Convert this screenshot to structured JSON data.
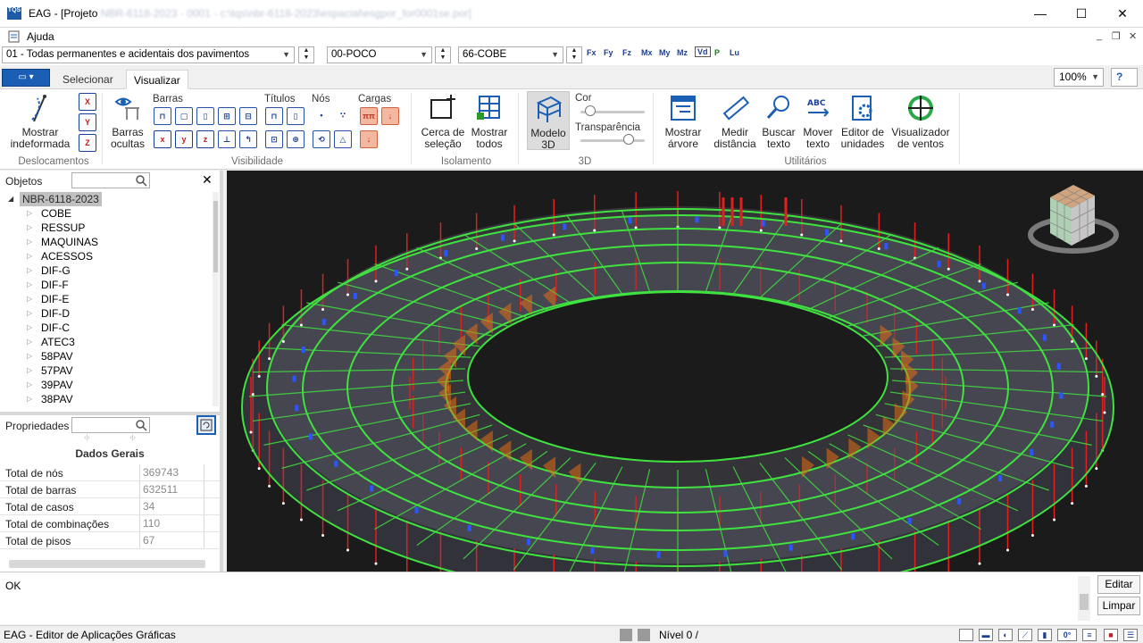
{
  "window": {
    "app_name": "EAG",
    "title_prefix": "EAG - [Projeto",
    "title_obscured": "NBR-6118-2023 - 0001 - c:\\tqs\\nbr-6118-2023\\espacial\\esgpor_for0001se.por]",
    "icon_label": "TQS",
    "minimize": "—",
    "maximize": "☐",
    "close": "✕"
  },
  "menu": {
    "help": "Ajuda",
    "mdi_minimize": "_",
    "mdi_restore": "❐",
    "mdi_close": "✕"
  },
  "selectors": {
    "case_combo": "01 - Todas permanentes e acidentais dos pavimentos",
    "floor_from": "00-POCO",
    "floor_to": "66-COBE",
    "toolbar_icons": [
      "Fx",
      "Fy",
      "Fz",
      "Mx",
      "My",
      "Mz",
      "Vd",
      "P",
      "Lu"
    ]
  },
  "tabs": {
    "app_menu": "▭ ▾",
    "items": [
      "Selecionar",
      "Visualizar"
    ],
    "active": "Visualizar"
  },
  "zoom": {
    "value": "100%",
    "help": "?"
  },
  "ribbon": {
    "deslocamentos": {
      "group_label": "Deslocamentos",
      "show_deformed": "Mostrar indeformada",
      "axes": [
        "X",
        "Y",
        "Z"
      ]
    },
    "visibilidade": {
      "group_label": "Visibilidade",
      "hidden_bars": "Barras ocultas",
      "barras_header": "Barras",
      "titulos_header": "Títulos",
      "nos_header": "Nós",
      "cargas_header": "Cargas"
    },
    "isolamento": {
      "group_label": "Isolamento",
      "fence_selection": "Cerca de seleção",
      "show_all": "Mostrar todos"
    },
    "view3d": {
      "group_label": "3D",
      "model_3d": "Modelo 3D",
      "color": "Cor",
      "transparency": "Transparência",
      "color_level": 0.15,
      "transparency_level": 0.75
    },
    "utilitarios": {
      "group_label": "Utilitários",
      "show_tree": "Mostrar árvore",
      "measure": "Medir distância",
      "find_text": "Buscar texto",
      "move_text": "Mover texto",
      "unit_editor": "Editor de unidades",
      "wind_viewer": "Visualizador de ventos"
    }
  },
  "objects_panel": {
    "title": "Objetos",
    "close": "✕",
    "root": "NBR-6118-2023",
    "items": [
      "COBE",
      "RESSUP",
      "MAQUINAS",
      "ACESSOS",
      "DIF-G",
      "DIF-F",
      "DIF-E",
      "DIF-D",
      "DIF-C",
      "ATEC3",
      "58PAV",
      "57PAV",
      "39PAV",
      "38PAV"
    ]
  },
  "properties_panel": {
    "title": "Propriedades",
    "section": "Dados Gerais",
    "rows": [
      {
        "key": "Total de nós",
        "value": "369743"
      },
      {
        "key": "Total de barras",
        "value": "632511"
      },
      {
        "key": "Total de casos",
        "value": "34"
      },
      {
        "key": "Total de combinações",
        "value": "110"
      },
      {
        "key": "Total de pisos",
        "value": "67"
      }
    ]
  },
  "output": {
    "text": "OK",
    "edit": "Editar",
    "clear": "Limpar"
  },
  "status": {
    "app_desc": "EAG - Editor de Aplicações Gráficas",
    "level": "Nível 0 /",
    "angle": "0°"
  },
  "colors": {
    "accent": "#1b5fb4",
    "frame_green": "#3fe23f",
    "viewport_bg": "#1b1b1b",
    "column_red": "#e02020"
  }
}
